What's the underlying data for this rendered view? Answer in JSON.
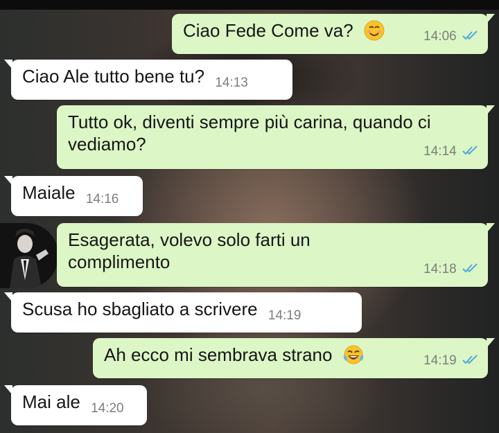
{
  "chat": {
    "messages": [
      {
        "direction": "out",
        "text": "Ciao Fede Come va?",
        "emoji": "smiling-face-icon",
        "time": "14:06",
        "status": "read"
      },
      {
        "direction": "in",
        "text": "Ciao Ale tutto bene tu?",
        "time": "14:13"
      },
      {
        "direction": "out",
        "text": "Tutto ok, diventi sempre più carina, quando ci vediamo?",
        "time": "14:14",
        "status": "read"
      },
      {
        "direction": "in",
        "text": "Maiale",
        "time": "14:16"
      },
      {
        "direction": "out",
        "text": "Esagerata, volevo solo farti un complimento",
        "time": "14:18",
        "status": "read"
      },
      {
        "direction": "in",
        "text": "Scusa ho sbagliato a scrivere",
        "time": "14:19"
      },
      {
        "direction": "out",
        "text": "Ah ecco mi sembrava strano",
        "emoji": "tears-of-joy-icon",
        "time": "14:19",
        "status": "read"
      },
      {
        "direction": "in",
        "text": "Mai ale",
        "time": "14:20"
      }
    ]
  },
  "colors": {
    "outgoing_bubble": "#dcf6c6",
    "incoming_bubble": "#ffffff",
    "read_ticks": "#4fa8e0",
    "timestamp": "#7a7f7a"
  }
}
